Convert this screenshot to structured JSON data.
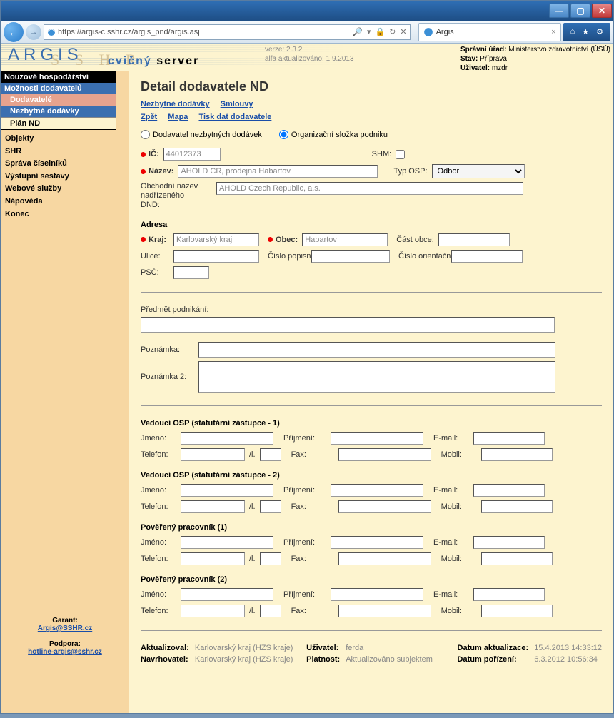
{
  "browser": {
    "url": "https://argis-c.sshr.cz/argis_pnd/argis.asj",
    "tab_title": "Argis"
  },
  "header": {
    "logo": "ARGIS",
    "server_line_1": "cvičný",
    "server_line_2": "server",
    "version_label": "verze:",
    "version": "2.3.2",
    "updated_label": "alfa aktualizováno:",
    "updated": "1.9.2013",
    "admin": {
      "office_label": "Správní úřad:",
      "office": "Ministerstvo zdravotnictví (ÚSÚ)",
      "state_label": "Stav:",
      "state": "Příprava",
      "user_label": "Uživatel:",
      "user": "mzdr"
    }
  },
  "sidebar": {
    "heading": "Nouzové hospodářství",
    "section1": "Možnosti dodavatelů",
    "item_dodavatele": "Dodavatelé",
    "item_nezbytne": "Nezbytné dodávky",
    "item_plan": "Plán ND",
    "links": {
      "objekty": "Objekty",
      "shr": "SHR",
      "sprava": "Správa číselníků",
      "vystupni": "Výstupní sestavy",
      "webove": "Webové služby",
      "napoveda": "Nápověda",
      "konec": "Konec"
    },
    "garant": {
      "g_label": "Garant:",
      "g_mail": "Argis@SSHR.cz",
      "s_label": "Podpora:",
      "s_mail": "hotline-argis@sshr.cz"
    }
  },
  "page": {
    "title": "Detail dodavatele ND",
    "links1": {
      "nezbytne": "Nezbytné dodávky",
      "smlouvy": "Smlouvy"
    },
    "links2": {
      "zpet": "Zpět",
      "mapa": "Mapa",
      "tisk": "Tisk dat dodavatele"
    },
    "radio_dnd": "Dodavatel nezbytných dodávek",
    "radio_osp": "Organizační složka podniku",
    "ic_label": "IČ:",
    "ic": "44012373",
    "shm_label": "SHM:",
    "nazev_label": "Název:",
    "nazev": "AHOLD CR, prodejna Habartov",
    "typosp_label": "Typ OSP:",
    "typosp": "Odbor",
    "parent_label1": "Obchodní název",
    "parent_label2": "nadřízeného",
    "parent_label3": "DND:",
    "parent": "AHOLD Czech Republic, a.s.",
    "adresa_heading": "Adresa",
    "kraj_label": "Kraj:",
    "kraj": "Karlovarský kraj",
    "obec_label": "Obec:",
    "obec": "Habartov",
    "castobce_label": "Část obce:",
    "ulice_label": "Ulice:",
    "cp_label": "Číslo popisné:",
    "co_label": "Číslo orientační:",
    "psc_label": "PSČ:",
    "predmet_label": "Předmět podnikání:",
    "pozn1_label": "Poznámka:",
    "pozn2_label": "Poznámka 2:",
    "person1_h": "Vedoucí OSP (statutární zástupce - 1)",
    "person2_h": "Vedoucí OSP (statutární zástupce - 2)",
    "person3_h": "Pověřený pracovník (1)",
    "person4_h": "Pověřený pracovník (2)",
    "jmeno": "Jméno:",
    "prijmeni": "Příjmení:",
    "email": "E-mail:",
    "telefon": "Telefon:",
    "linka": "/l.",
    "fax": "Fax:",
    "mobil": "Mobil:",
    "footer": {
      "aktualizoval_l": "Aktualizoval:",
      "aktualizoval_v": "Karlovarský kraj (HZS kraje)",
      "uzivatel_l": "Uživatel:",
      "uzivatel_v": "ferda",
      "datum_akt_l": "Datum aktualizace:",
      "datum_akt_v": "15.4.2013 14:33:12",
      "navrhovatel_l": "Navrhovatel:",
      "navrhovatel_v": "Karlovarský kraj (HZS kraje)",
      "platnost_l": "Platnost:",
      "platnost_v": "Aktualizováno subjektem",
      "datum_por_l": "Datum pořízení:",
      "datum_por_v": "6.3.2012 10:56:34"
    }
  }
}
